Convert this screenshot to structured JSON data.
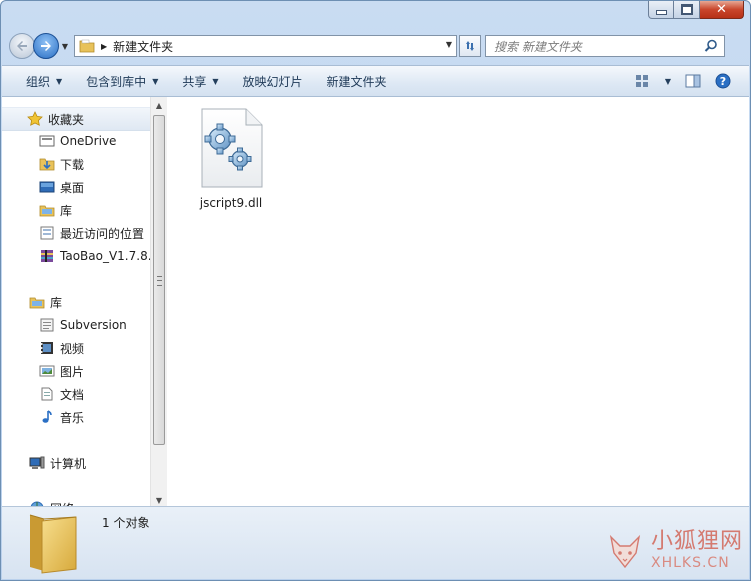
{
  "window": {
    "controls": {
      "minimize": "minimize-icon",
      "maximize": "maximize-icon",
      "close": "close-icon"
    }
  },
  "address": {
    "path": "新建文件夹",
    "search_placeholder": "搜索 新建文件夹"
  },
  "toolbar": {
    "organize": "组织",
    "include_library": "包含到库中",
    "share": "共享",
    "slideshow": "放映幻灯片",
    "new_folder": "新建文件夹"
  },
  "nav": {
    "favorites": "收藏夹",
    "onedrive": "OneDrive",
    "downloads": "下载",
    "desktop": "桌面",
    "library_fav": "库",
    "recent": "最近访问的位置",
    "taobao": "TaoBao_V1.7.8.",
    "libraries": "库",
    "subversion": "Subversion",
    "videos": "视频",
    "pictures": "图片",
    "documents": "文档",
    "music": "音乐",
    "computer": "计算机",
    "network": "网络"
  },
  "files": [
    {
      "name": "jscript9.dll",
      "icon": "dll-gear-icon"
    }
  ],
  "details": {
    "count_text": "1 个对象"
  },
  "watermark": {
    "cn": "小狐狸网",
    "en": "XHLKS.CN"
  },
  "colors": {
    "accent": "#2a6fc4",
    "close": "#c9462c",
    "watermark": "#d47a70"
  }
}
